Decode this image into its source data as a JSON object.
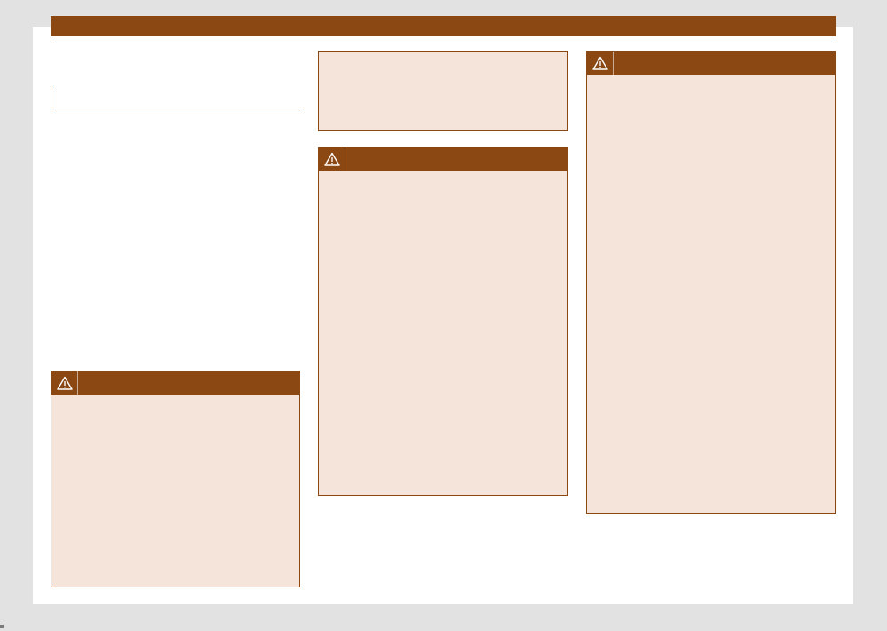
{
  "page": {
    "colors": {
      "accent": "#8b4813",
      "panel": "#f4e4d9",
      "background": "#e2e2e2"
    }
  },
  "header": {
    "title": ""
  },
  "section": {
    "heading": ""
  },
  "note_box": {
    "text": ""
  },
  "warning_boxes": [
    {
      "icon": "warning-triangle-icon",
      "title": "",
      "text": ""
    },
    {
      "icon": "warning-triangle-icon",
      "title": "",
      "text": ""
    },
    {
      "icon": "warning-triangle-icon",
      "title": "",
      "text": ""
    }
  ]
}
